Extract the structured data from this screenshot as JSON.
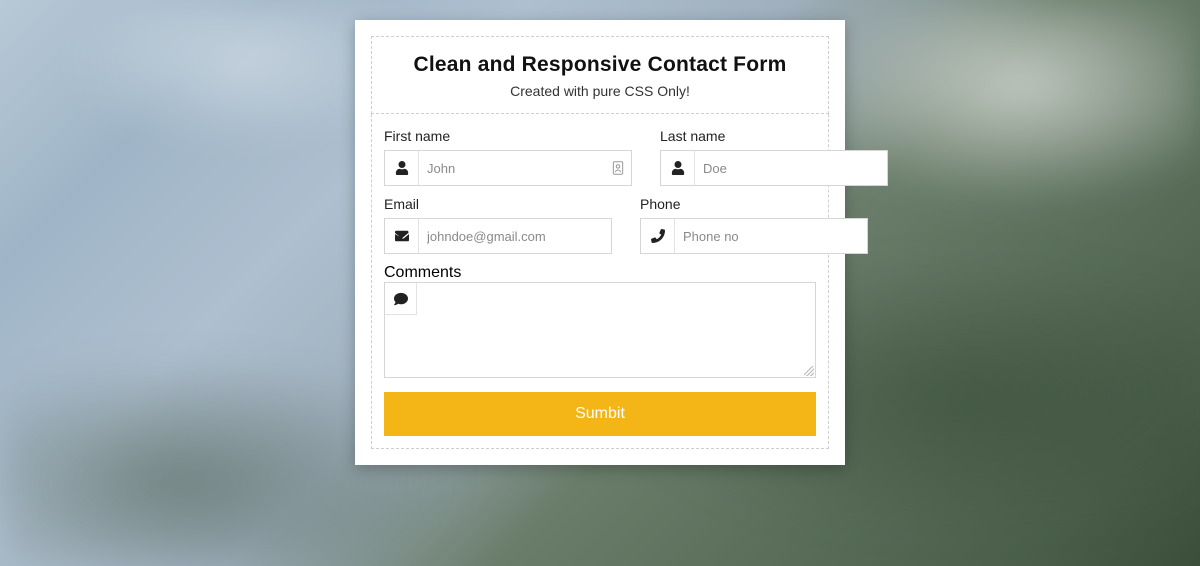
{
  "header": {
    "title": "Clean and Responsive Contact Form",
    "subtitle": "Created with pure CSS Only!"
  },
  "fields": {
    "first_name": {
      "label": "First name",
      "placeholder": "John"
    },
    "last_name": {
      "label": "Last name",
      "placeholder": "Doe"
    },
    "email": {
      "label": "Email",
      "placeholder": "johndoe@gmail.com"
    },
    "phone": {
      "label": "Phone",
      "placeholder": "Phone no"
    },
    "comments": {
      "label": "Comments",
      "placeholder": ""
    }
  },
  "submit": {
    "label": "Sumbit"
  },
  "colors": {
    "accent": "#f4b617"
  }
}
